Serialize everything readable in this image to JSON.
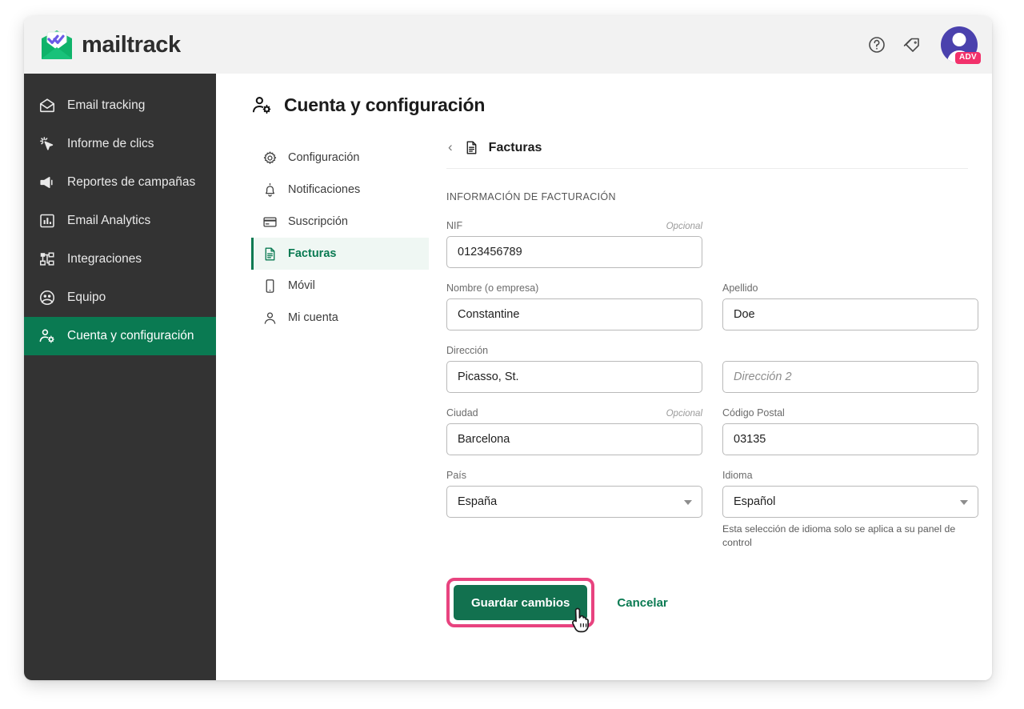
{
  "brand": {
    "name": "mailtrack",
    "logo_icon": "mailtrack-envelope-checkmarks-icon"
  },
  "topbar": {
    "help_icon": "question-circle-icon",
    "offers_icon": "price-tag-icon",
    "avatar_icon": "user-avatar-icon",
    "avatar_badge": "ADV",
    "avatar_color": "#4a41ad",
    "badge_color": "#f2316b"
  },
  "sidebar": {
    "items": [
      {
        "label": "Email tracking",
        "icon": "envelope-icon",
        "active": false
      },
      {
        "label": "Informe de clics",
        "icon": "click-cursor-icon",
        "active": false
      },
      {
        "label": "Reportes de campañas",
        "icon": "megaphone-icon",
        "active": false
      },
      {
        "label": "Email Analytics",
        "icon": "bar-chart-icon",
        "active": false
      },
      {
        "label": "Integraciones",
        "icon": "sitemap-icon",
        "active": false
      },
      {
        "label": "Equipo",
        "icon": "people-circle-icon",
        "active": false
      },
      {
        "label": "Cuenta y configuración",
        "icon": "user-gear-icon",
        "active": true
      }
    ],
    "active_color": "#0a7a52",
    "background": "#333333"
  },
  "page": {
    "title": "Cuenta y configuración",
    "title_icon": "user-gear-icon"
  },
  "subnav": {
    "items": [
      {
        "label": "Configuración",
        "icon": "gear-icon",
        "active": false
      },
      {
        "label": "Notificaciones",
        "icon": "bell-icon",
        "active": false
      },
      {
        "label": "Suscripción",
        "icon": "credit-card-icon",
        "active": false
      },
      {
        "label": "Facturas",
        "icon": "document-icon",
        "active": true
      },
      {
        "label": "Móvil",
        "icon": "mobile-phone-icon",
        "active": false
      },
      {
        "label": "Mi cuenta",
        "icon": "person-icon",
        "active": false
      }
    ]
  },
  "panel": {
    "back_icon": "chevron-left-icon",
    "head_icon": "document-icon",
    "title": "Facturas",
    "section_label": "INFORMACIÓN DE FACTURACIÓN"
  },
  "form": {
    "nif": {
      "label": "NIF",
      "optional": "Opcional",
      "value": "0123456789",
      "placeholder": ""
    },
    "nombre": {
      "label": "Nombre (o empresa)",
      "optional": "",
      "value": "Constantine",
      "placeholder": ""
    },
    "apellido": {
      "label": "Apellido",
      "optional": "",
      "value": "Doe",
      "placeholder": ""
    },
    "direccion": {
      "label": "Dirección",
      "optional": "",
      "value": "Picasso, St.",
      "placeholder": ""
    },
    "direccion2": {
      "label": "",
      "optional": "",
      "value": "",
      "placeholder": "Dirección 2"
    },
    "ciudad": {
      "label": "Ciudad",
      "optional": "Opcional",
      "value": "Barcelona",
      "placeholder": ""
    },
    "codigo_postal": {
      "label": "Código Postal",
      "optional": "",
      "value": "03135",
      "placeholder": ""
    },
    "pais": {
      "label": "País",
      "optional": "",
      "value": "España",
      "caret_icon": "chevron-down-icon"
    },
    "idioma": {
      "label": "Idioma",
      "optional": "",
      "value": "Español",
      "caret_icon": "chevron-down-icon",
      "hint": "Esta selección de idioma solo se aplica a su panel de control"
    }
  },
  "actions": {
    "save_label": "Guardar cambios",
    "cancel_label": "Cancelar",
    "save_color": "#12714f",
    "highlight_color": "#e8437f",
    "cursor_icon": "pointer-hand-cursor-icon"
  }
}
